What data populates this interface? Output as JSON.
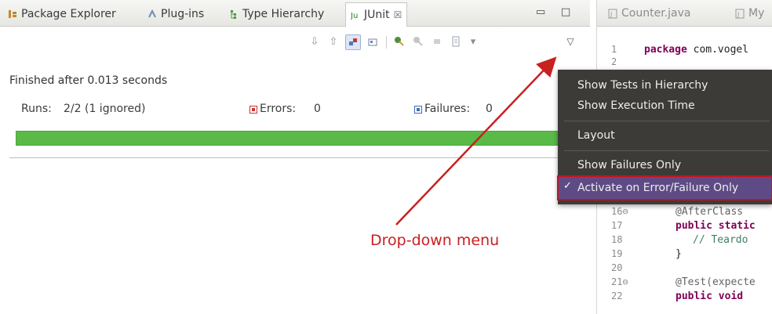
{
  "view_tabs": [
    {
      "label": "Package Explorer",
      "icon": "package-explorer-icon"
    },
    {
      "label": "Plug-ins",
      "icon": "plugins-icon"
    },
    {
      "label": "Type Hierarchy",
      "icon": "type-hierarchy-icon"
    },
    {
      "label": "JUnit",
      "icon": "junit-icon",
      "close": "☒"
    }
  ],
  "view_controls": {
    "minimize": "▭",
    "maximize": "□"
  },
  "status": {
    "finished": "Finished after 0.013 seconds"
  },
  "counters": {
    "runs_label": "Runs:",
    "runs_value": "2/2 (1 ignored)",
    "errors_label": "Errors:",
    "errors_value": "0",
    "failures_label": "Failures:",
    "failures_value": "0"
  },
  "progress": {
    "fraction": 1.0,
    "color": "#5aba47"
  },
  "menu": {
    "items": [
      "Show Tests in Hierarchy",
      "Show Execution Time",
      "Layout",
      "Show Failures Only",
      "Activate on Error/Failure Only"
    ],
    "checked_item": "Activate on Error/Failure Only",
    "check_mark": "✓"
  },
  "annotation": {
    "label": "Drop-down menu",
    "color": "#c8211f"
  },
  "editor": {
    "tabs": [
      "Counter.java",
      "My"
    ],
    "lines": [
      {
        "num": "1",
        "kw": "package",
        "rest": " com.vogel"
      },
      {
        "num": "2",
        "kw": "",
        "rest": ""
      },
      {
        "num": "16⊖",
        "kw": "",
        "rest": "@AfterClass"
      },
      {
        "num": "17",
        "kw": "public static",
        "rest": ""
      },
      {
        "num": "18",
        "kw": "",
        "rest": "// Teardo"
      },
      {
        "num": "19",
        "kw": "",
        "rest": "}"
      },
      {
        "num": "20",
        "kw": "",
        "rest": ""
      },
      {
        "num": "21⊖",
        "kw": "",
        "rest": "@Test(expecte"
      },
      {
        "num": "22",
        "kw": "public void",
        "rest": ""
      }
    ]
  }
}
